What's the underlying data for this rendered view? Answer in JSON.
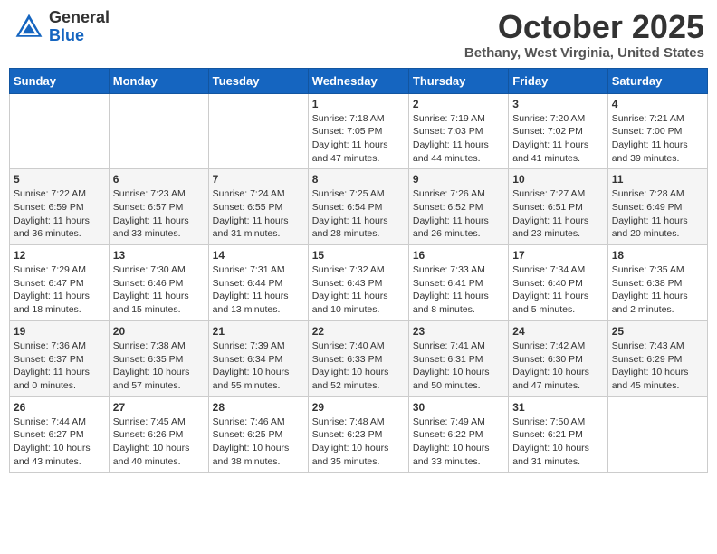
{
  "header": {
    "logo_general": "General",
    "logo_blue": "Blue",
    "month_title": "October 2025",
    "location": "Bethany, West Virginia, United States"
  },
  "days_of_week": [
    "Sunday",
    "Monday",
    "Tuesday",
    "Wednesday",
    "Thursday",
    "Friday",
    "Saturday"
  ],
  "weeks": [
    [
      {
        "day": "",
        "info": ""
      },
      {
        "day": "",
        "info": ""
      },
      {
        "day": "",
        "info": ""
      },
      {
        "day": "1",
        "info": "Sunrise: 7:18 AM\nSunset: 7:05 PM\nDaylight: 11 hours and 47 minutes."
      },
      {
        "day": "2",
        "info": "Sunrise: 7:19 AM\nSunset: 7:03 PM\nDaylight: 11 hours and 44 minutes."
      },
      {
        "day": "3",
        "info": "Sunrise: 7:20 AM\nSunset: 7:02 PM\nDaylight: 11 hours and 41 minutes."
      },
      {
        "day": "4",
        "info": "Sunrise: 7:21 AM\nSunset: 7:00 PM\nDaylight: 11 hours and 39 minutes."
      }
    ],
    [
      {
        "day": "5",
        "info": "Sunrise: 7:22 AM\nSunset: 6:59 PM\nDaylight: 11 hours and 36 minutes."
      },
      {
        "day": "6",
        "info": "Sunrise: 7:23 AM\nSunset: 6:57 PM\nDaylight: 11 hours and 33 minutes."
      },
      {
        "day": "7",
        "info": "Sunrise: 7:24 AM\nSunset: 6:55 PM\nDaylight: 11 hours and 31 minutes."
      },
      {
        "day": "8",
        "info": "Sunrise: 7:25 AM\nSunset: 6:54 PM\nDaylight: 11 hours and 28 minutes."
      },
      {
        "day": "9",
        "info": "Sunrise: 7:26 AM\nSunset: 6:52 PM\nDaylight: 11 hours and 26 minutes."
      },
      {
        "day": "10",
        "info": "Sunrise: 7:27 AM\nSunset: 6:51 PM\nDaylight: 11 hours and 23 minutes."
      },
      {
        "day": "11",
        "info": "Sunrise: 7:28 AM\nSunset: 6:49 PM\nDaylight: 11 hours and 20 minutes."
      }
    ],
    [
      {
        "day": "12",
        "info": "Sunrise: 7:29 AM\nSunset: 6:47 PM\nDaylight: 11 hours and 18 minutes."
      },
      {
        "day": "13",
        "info": "Sunrise: 7:30 AM\nSunset: 6:46 PM\nDaylight: 11 hours and 15 minutes."
      },
      {
        "day": "14",
        "info": "Sunrise: 7:31 AM\nSunset: 6:44 PM\nDaylight: 11 hours and 13 minutes."
      },
      {
        "day": "15",
        "info": "Sunrise: 7:32 AM\nSunset: 6:43 PM\nDaylight: 11 hours and 10 minutes."
      },
      {
        "day": "16",
        "info": "Sunrise: 7:33 AM\nSunset: 6:41 PM\nDaylight: 11 hours and 8 minutes."
      },
      {
        "day": "17",
        "info": "Sunrise: 7:34 AM\nSunset: 6:40 PM\nDaylight: 11 hours and 5 minutes."
      },
      {
        "day": "18",
        "info": "Sunrise: 7:35 AM\nSunset: 6:38 PM\nDaylight: 11 hours and 2 minutes."
      }
    ],
    [
      {
        "day": "19",
        "info": "Sunrise: 7:36 AM\nSunset: 6:37 PM\nDaylight: 11 hours and 0 minutes."
      },
      {
        "day": "20",
        "info": "Sunrise: 7:38 AM\nSunset: 6:35 PM\nDaylight: 10 hours and 57 minutes."
      },
      {
        "day": "21",
        "info": "Sunrise: 7:39 AM\nSunset: 6:34 PM\nDaylight: 10 hours and 55 minutes."
      },
      {
        "day": "22",
        "info": "Sunrise: 7:40 AM\nSunset: 6:33 PM\nDaylight: 10 hours and 52 minutes."
      },
      {
        "day": "23",
        "info": "Sunrise: 7:41 AM\nSunset: 6:31 PM\nDaylight: 10 hours and 50 minutes."
      },
      {
        "day": "24",
        "info": "Sunrise: 7:42 AM\nSunset: 6:30 PM\nDaylight: 10 hours and 47 minutes."
      },
      {
        "day": "25",
        "info": "Sunrise: 7:43 AM\nSunset: 6:29 PM\nDaylight: 10 hours and 45 minutes."
      }
    ],
    [
      {
        "day": "26",
        "info": "Sunrise: 7:44 AM\nSunset: 6:27 PM\nDaylight: 10 hours and 43 minutes."
      },
      {
        "day": "27",
        "info": "Sunrise: 7:45 AM\nSunset: 6:26 PM\nDaylight: 10 hours and 40 minutes."
      },
      {
        "day": "28",
        "info": "Sunrise: 7:46 AM\nSunset: 6:25 PM\nDaylight: 10 hours and 38 minutes."
      },
      {
        "day": "29",
        "info": "Sunrise: 7:48 AM\nSunset: 6:23 PM\nDaylight: 10 hours and 35 minutes."
      },
      {
        "day": "30",
        "info": "Sunrise: 7:49 AM\nSunset: 6:22 PM\nDaylight: 10 hours and 33 minutes."
      },
      {
        "day": "31",
        "info": "Sunrise: 7:50 AM\nSunset: 6:21 PM\nDaylight: 10 hours and 31 minutes."
      },
      {
        "day": "",
        "info": ""
      }
    ]
  ]
}
